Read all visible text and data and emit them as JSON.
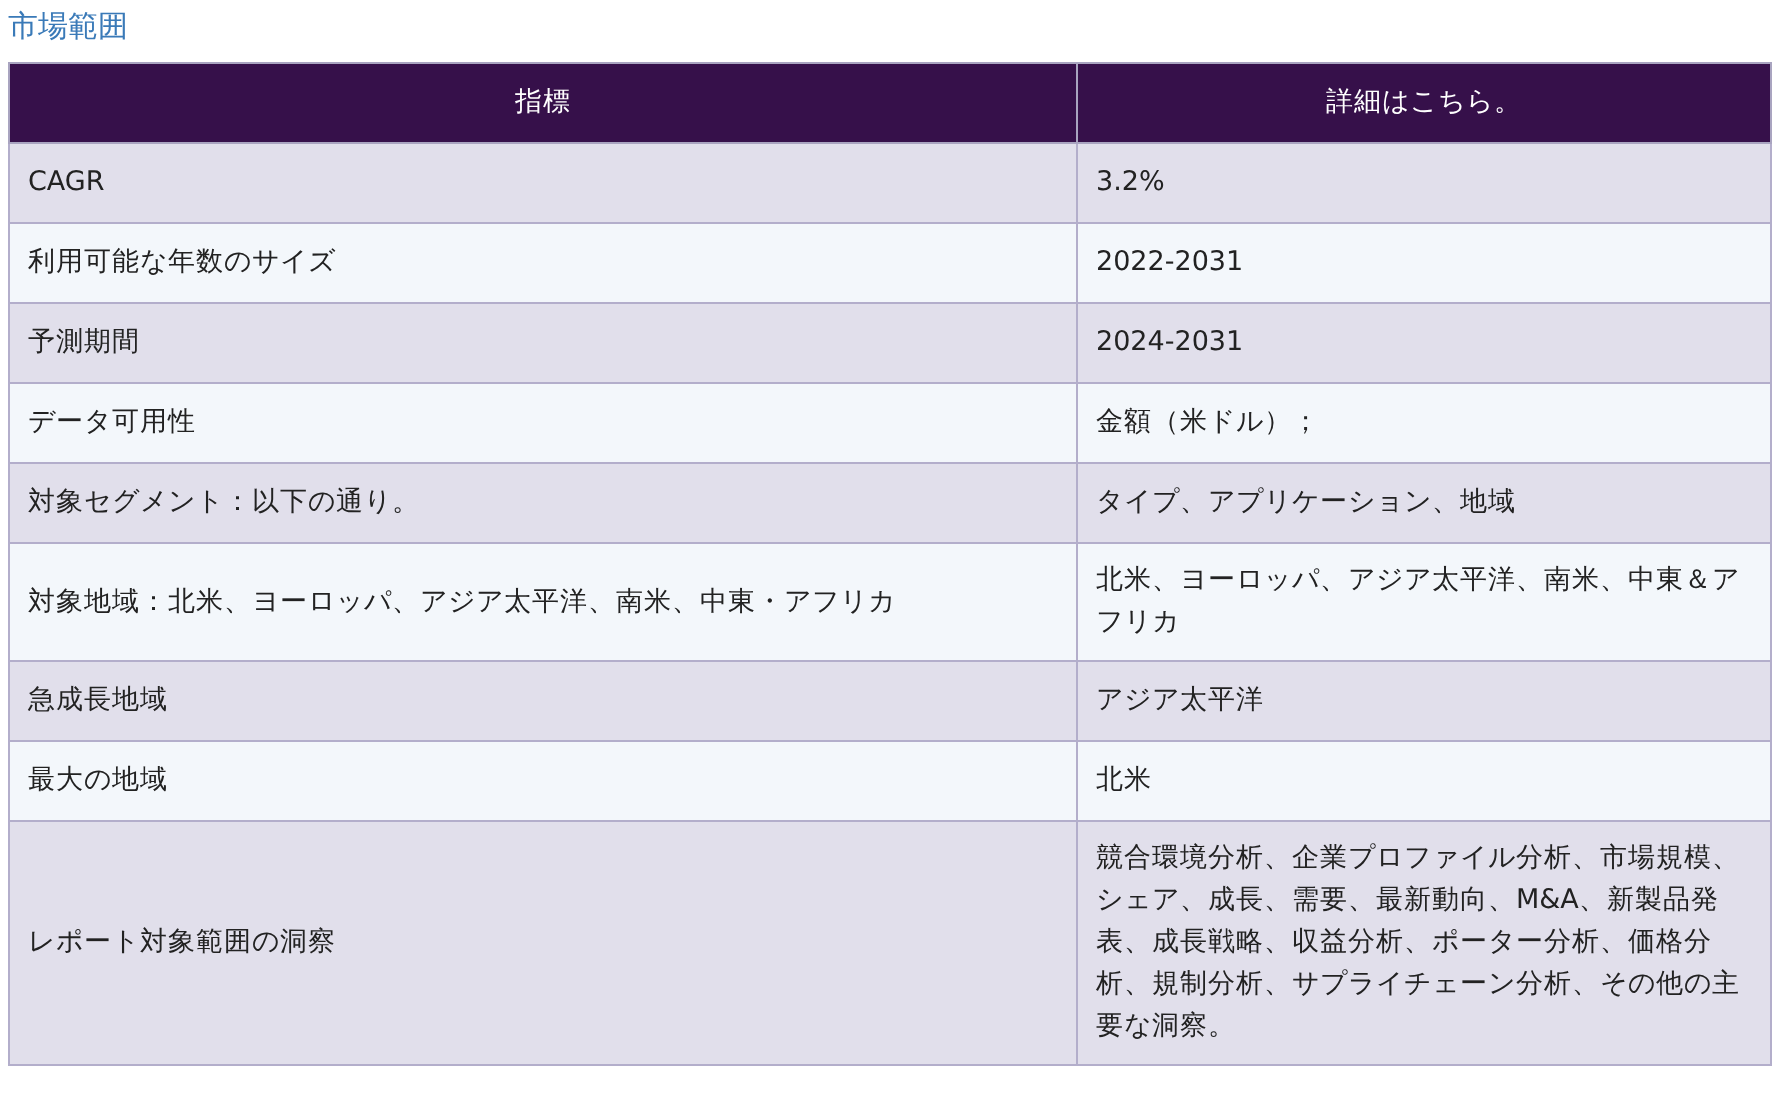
{
  "title": "市場範囲",
  "table": {
    "columns": [
      "指標",
      "詳細はこちら。"
    ],
    "rows": [
      [
        "CAGR",
        "3.2%"
      ],
      [
        "利用可能な年数のサイズ",
        "2022-2031"
      ],
      [
        "予測期間",
        "2024-2031"
      ],
      [
        "データ可用性",
        "金額（米ドル）；"
      ],
      [
        "対象セグメント：以下の通り。",
        "タイプ、アプリケーション、地域"
      ],
      [
        "対象地域：北米、ヨーロッパ、アジア太平洋、南米、中東・アフリカ",
        "北米、ヨーロッパ、アジア太平洋、南米、中東＆アフリカ"
      ],
      [
        "急成長地域",
        "アジア太平洋"
      ],
      [
        "最大の地域",
        "北米"
      ],
      [
        "レポート対象範囲の洞察",
        "競合環境分析、企業プロファイル分析、市場規模、シェア、成長、需要、最新動向、M&A、新製品発表、成長戦略、収益分析、ポーター分析、価格分析、規制分析、サプライチェーン分析、その他の主要な洞察。"
      ]
    ]
  }
}
